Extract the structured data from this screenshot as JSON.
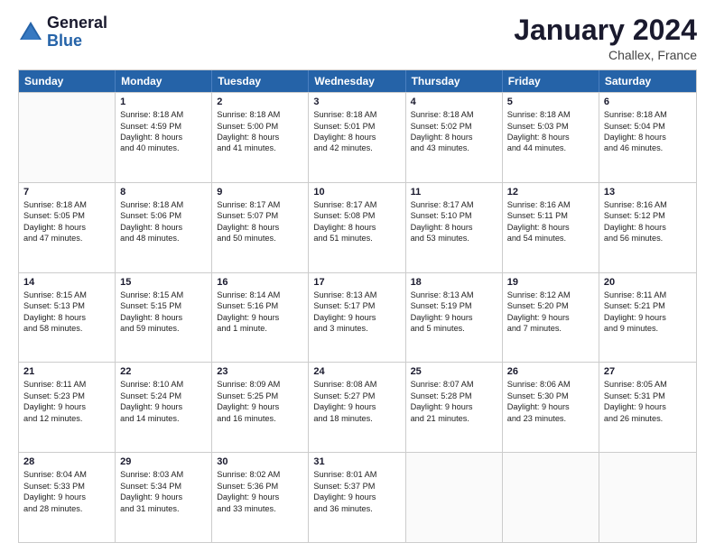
{
  "logo": {
    "line1": "General",
    "line2": "Blue"
  },
  "title": "January 2024",
  "subtitle": "Challex, France",
  "header_days": [
    "Sunday",
    "Monday",
    "Tuesday",
    "Wednesday",
    "Thursday",
    "Friday",
    "Saturday"
  ],
  "weeks": [
    [
      {
        "day": "",
        "lines": []
      },
      {
        "day": "1",
        "lines": [
          "Sunrise: 8:18 AM",
          "Sunset: 4:59 PM",
          "Daylight: 8 hours",
          "and 40 minutes."
        ]
      },
      {
        "day": "2",
        "lines": [
          "Sunrise: 8:18 AM",
          "Sunset: 5:00 PM",
          "Daylight: 8 hours",
          "and 41 minutes."
        ]
      },
      {
        "day": "3",
        "lines": [
          "Sunrise: 8:18 AM",
          "Sunset: 5:01 PM",
          "Daylight: 8 hours",
          "and 42 minutes."
        ]
      },
      {
        "day": "4",
        "lines": [
          "Sunrise: 8:18 AM",
          "Sunset: 5:02 PM",
          "Daylight: 8 hours",
          "and 43 minutes."
        ]
      },
      {
        "day": "5",
        "lines": [
          "Sunrise: 8:18 AM",
          "Sunset: 5:03 PM",
          "Daylight: 8 hours",
          "and 44 minutes."
        ]
      },
      {
        "day": "6",
        "lines": [
          "Sunrise: 8:18 AM",
          "Sunset: 5:04 PM",
          "Daylight: 8 hours",
          "and 46 minutes."
        ]
      }
    ],
    [
      {
        "day": "7",
        "lines": [
          "Sunrise: 8:18 AM",
          "Sunset: 5:05 PM",
          "Daylight: 8 hours",
          "and 47 minutes."
        ]
      },
      {
        "day": "8",
        "lines": [
          "Sunrise: 8:18 AM",
          "Sunset: 5:06 PM",
          "Daylight: 8 hours",
          "and 48 minutes."
        ]
      },
      {
        "day": "9",
        "lines": [
          "Sunrise: 8:17 AM",
          "Sunset: 5:07 PM",
          "Daylight: 8 hours",
          "and 50 minutes."
        ]
      },
      {
        "day": "10",
        "lines": [
          "Sunrise: 8:17 AM",
          "Sunset: 5:08 PM",
          "Daylight: 8 hours",
          "and 51 minutes."
        ]
      },
      {
        "day": "11",
        "lines": [
          "Sunrise: 8:17 AM",
          "Sunset: 5:10 PM",
          "Daylight: 8 hours",
          "and 53 minutes."
        ]
      },
      {
        "day": "12",
        "lines": [
          "Sunrise: 8:16 AM",
          "Sunset: 5:11 PM",
          "Daylight: 8 hours",
          "and 54 minutes."
        ]
      },
      {
        "day": "13",
        "lines": [
          "Sunrise: 8:16 AM",
          "Sunset: 5:12 PM",
          "Daylight: 8 hours",
          "and 56 minutes."
        ]
      }
    ],
    [
      {
        "day": "14",
        "lines": [
          "Sunrise: 8:15 AM",
          "Sunset: 5:13 PM",
          "Daylight: 8 hours",
          "and 58 minutes."
        ]
      },
      {
        "day": "15",
        "lines": [
          "Sunrise: 8:15 AM",
          "Sunset: 5:15 PM",
          "Daylight: 8 hours",
          "and 59 minutes."
        ]
      },
      {
        "day": "16",
        "lines": [
          "Sunrise: 8:14 AM",
          "Sunset: 5:16 PM",
          "Daylight: 9 hours",
          "and 1 minute."
        ]
      },
      {
        "day": "17",
        "lines": [
          "Sunrise: 8:13 AM",
          "Sunset: 5:17 PM",
          "Daylight: 9 hours",
          "and 3 minutes."
        ]
      },
      {
        "day": "18",
        "lines": [
          "Sunrise: 8:13 AM",
          "Sunset: 5:19 PM",
          "Daylight: 9 hours",
          "and 5 minutes."
        ]
      },
      {
        "day": "19",
        "lines": [
          "Sunrise: 8:12 AM",
          "Sunset: 5:20 PM",
          "Daylight: 9 hours",
          "and 7 minutes."
        ]
      },
      {
        "day": "20",
        "lines": [
          "Sunrise: 8:11 AM",
          "Sunset: 5:21 PM",
          "Daylight: 9 hours",
          "and 9 minutes."
        ]
      }
    ],
    [
      {
        "day": "21",
        "lines": [
          "Sunrise: 8:11 AM",
          "Sunset: 5:23 PM",
          "Daylight: 9 hours",
          "and 12 minutes."
        ]
      },
      {
        "day": "22",
        "lines": [
          "Sunrise: 8:10 AM",
          "Sunset: 5:24 PM",
          "Daylight: 9 hours",
          "and 14 minutes."
        ]
      },
      {
        "day": "23",
        "lines": [
          "Sunrise: 8:09 AM",
          "Sunset: 5:25 PM",
          "Daylight: 9 hours",
          "and 16 minutes."
        ]
      },
      {
        "day": "24",
        "lines": [
          "Sunrise: 8:08 AM",
          "Sunset: 5:27 PM",
          "Daylight: 9 hours",
          "and 18 minutes."
        ]
      },
      {
        "day": "25",
        "lines": [
          "Sunrise: 8:07 AM",
          "Sunset: 5:28 PM",
          "Daylight: 9 hours",
          "and 21 minutes."
        ]
      },
      {
        "day": "26",
        "lines": [
          "Sunrise: 8:06 AM",
          "Sunset: 5:30 PM",
          "Daylight: 9 hours",
          "and 23 minutes."
        ]
      },
      {
        "day": "27",
        "lines": [
          "Sunrise: 8:05 AM",
          "Sunset: 5:31 PM",
          "Daylight: 9 hours",
          "and 26 minutes."
        ]
      }
    ],
    [
      {
        "day": "28",
        "lines": [
          "Sunrise: 8:04 AM",
          "Sunset: 5:33 PM",
          "Daylight: 9 hours",
          "and 28 minutes."
        ]
      },
      {
        "day": "29",
        "lines": [
          "Sunrise: 8:03 AM",
          "Sunset: 5:34 PM",
          "Daylight: 9 hours",
          "and 31 minutes."
        ]
      },
      {
        "day": "30",
        "lines": [
          "Sunrise: 8:02 AM",
          "Sunset: 5:36 PM",
          "Daylight: 9 hours",
          "and 33 minutes."
        ]
      },
      {
        "day": "31",
        "lines": [
          "Sunrise: 8:01 AM",
          "Sunset: 5:37 PM",
          "Daylight: 9 hours",
          "and 36 minutes."
        ]
      },
      {
        "day": "",
        "lines": []
      },
      {
        "day": "",
        "lines": []
      },
      {
        "day": "",
        "lines": []
      }
    ]
  ]
}
